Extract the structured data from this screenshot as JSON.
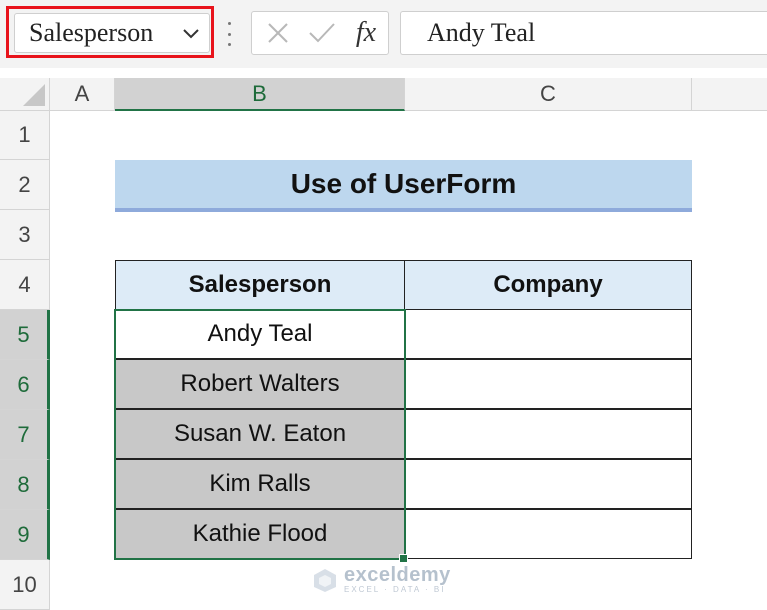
{
  "formula_bar": {
    "name_box": "Salesperson",
    "formula_value": "Andy Teal",
    "fx_label": "fx",
    "cancel_icon": "cancel-x-icon",
    "enter_icon": "checkmark-icon",
    "highlight_color": "#e8131b"
  },
  "columns": [
    {
      "label": "A",
      "selected": false
    },
    {
      "label": "B",
      "selected": true
    },
    {
      "label": "C",
      "selected": false
    }
  ],
  "rows": [
    {
      "label": "1",
      "selected": false
    },
    {
      "label": "2",
      "selected": false
    },
    {
      "label": "3",
      "selected": false
    },
    {
      "label": "4",
      "selected": false
    },
    {
      "label": "5",
      "selected": true
    },
    {
      "label": "6",
      "selected": true
    },
    {
      "label": "7",
      "selected": true
    },
    {
      "label": "8",
      "selected": true
    },
    {
      "label": "9",
      "selected": true
    },
    {
      "label": "10",
      "selected": false
    }
  ],
  "sheet": {
    "title": "Use of UserForm",
    "table": {
      "headers": [
        "Salesperson",
        "Company"
      ],
      "rows": [
        [
          "Andy Teal",
          ""
        ],
        [
          "Robert Walters",
          ""
        ],
        [
          "Susan W. Eaton",
          ""
        ],
        [
          "Kim Ralls",
          ""
        ],
        [
          "Kathie Flood",
          ""
        ]
      ]
    }
  },
  "colors": {
    "title_fill": "#bdd7ee",
    "header_fill": "#ddebf7",
    "selection": "#217346",
    "selected_fill": "#c8c8c8"
  },
  "watermark": {
    "name": "exceldemy",
    "tagline": "EXCEL · DATA · BI"
  }
}
